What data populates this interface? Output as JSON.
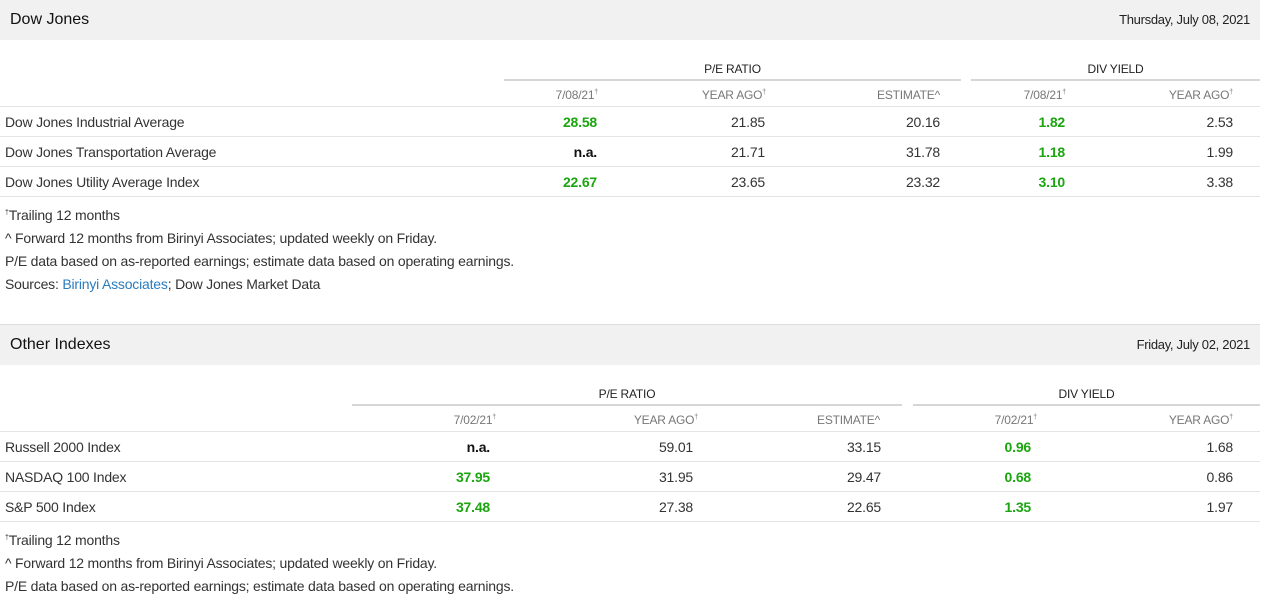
{
  "colors": {
    "header_bg": "#f1f1f1",
    "positive": "#1ba60f",
    "link": "#2a7bbd"
  },
  "sections": [
    {
      "title": "Dow Jones",
      "date": "Thursday, July 08, 2021",
      "pe_group": "P/E RATIO",
      "div_group": "DIV YIELD",
      "columns": [
        "7/08/21",
        "YEAR AGO",
        "ESTIMATE",
        "7/08/21",
        "YEAR AGO"
      ],
      "column_marks": [
        "†",
        "†",
        "^",
        "†",
        "†"
      ],
      "rows": [
        {
          "name": "Dow Jones Industrial Average",
          "pe": "28.58",
          "pe_year_ago": "21.85",
          "estimate": "20.16",
          "div": "1.82",
          "div_year_ago": "2.53"
        },
        {
          "name": "Dow Jones Transportation Average",
          "pe": "n.a.",
          "pe_year_ago": "21.71",
          "estimate": "31.78",
          "div": "1.18",
          "div_year_ago": "1.99"
        },
        {
          "name": "Dow Jones Utility Average Index",
          "pe": "22.67",
          "pe_year_ago": "23.65",
          "estimate": "23.32",
          "div": "3.10",
          "div_year_ago": "3.38"
        }
      ],
      "notes": {
        "trailing": "Trailing 12 months",
        "forward": "^ Forward 12 months from Birinyi Associates; updated weekly on Friday.",
        "pe_data": "P/E data based on as-reported earnings; estimate data based on operating earnings.",
        "sources_prefix": "Sources: ",
        "sources_link": "Birinyi Associates",
        "sources_suffix": "; Dow Jones Market Data"
      }
    },
    {
      "title": "Other Indexes",
      "date": "Friday, July 02, 2021",
      "pe_group": "P/E RATIO",
      "div_group": "DIV YIELD",
      "columns": [
        "7/02/21",
        "YEAR AGO",
        "ESTIMATE",
        "7/02/21",
        "YEAR AGO"
      ],
      "column_marks": [
        "†",
        "†",
        "^",
        "†",
        "†"
      ],
      "rows": [
        {
          "name": "Russell 2000 Index",
          "pe": "n.a.",
          "pe_year_ago": "59.01",
          "estimate": "33.15",
          "div": "0.96",
          "div_year_ago": "1.68"
        },
        {
          "name": "NASDAQ 100 Index",
          "pe": "37.95",
          "pe_year_ago": "31.95",
          "estimate": "29.47",
          "div": "0.68",
          "div_year_ago": "0.86"
        },
        {
          "name": "S&P 500 Index",
          "pe": "37.48",
          "pe_year_ago": "27.38",
          "estimate": "22.65",
          "div": "1.35",
          "div_year_ago": "1.97"
        }
      ],
      "notes": {
        "trailing": "Trailing 12 months",
        "forward": "^ Forward 12 months from Birinyi Associates; updated weekly on Friday.",
        "pe_data": "P/E data based on as-reported earnings; estimate data based on operating earnings."
      }
    }
  ]
}
